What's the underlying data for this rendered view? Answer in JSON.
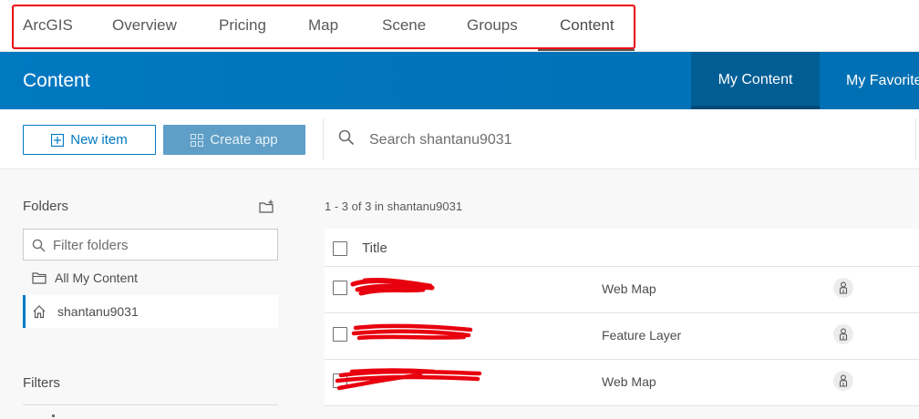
{
  "topnav": {
    "items": [
      {
        "label": "ArcGIS"
      },
      {
        "label": "Overview"
      },
      {
        "label": "Pricing"
      },
      {
        "label": "Map"
      },
      {
        "label": "Scene"
      },
      {
        "label": "Groups"
      },
      {
        "label": "Content"
      }
    ],
    "active": "Content",
    "highlight_color": "#e8000e"
  },
  "header": {
    "title": "Content",
    "tabs": [
      {
        "label": "My Content",
        "active": true
      },
      {
        "label": "My Favorite"
      }
    ],
    "bg_color": "#0079c1"
  },
  "toolbar": {
    "new_item_label": "New item",
    "create_app_label": "Create app",
    "search_placeholder": "Search shantanu9031"
  },
  "sidebar": {
    "folders_title": "Folders",
    "filter_placeholder": "Filter folders",
    "folders": [
      {
        "label": "All My Content",
        "icon": "folder-icon"
      },
      {
        "label": "shantanu9031",
        "icon": "home-icon",
        "selected": true
      }
    ],
    "filters_title": "Filters"
  },
  "main": {
    "count_text": "1 - 3 of 3 in shantanu9031",
    "columns": {
      "title": "Title"
    },
    "rows": [
      {
        "title": "",
        "type": "Web Map",
        "share_icon": "person-icon"
      },
      {
        "title": "",
        "type": "Feature Layer",
        "share_icon": "person-icon"
      },
      {
        "title": "",
        "type": "Web Map",
        "share_icon": "person-icon"
      }
    ]
  }
}
